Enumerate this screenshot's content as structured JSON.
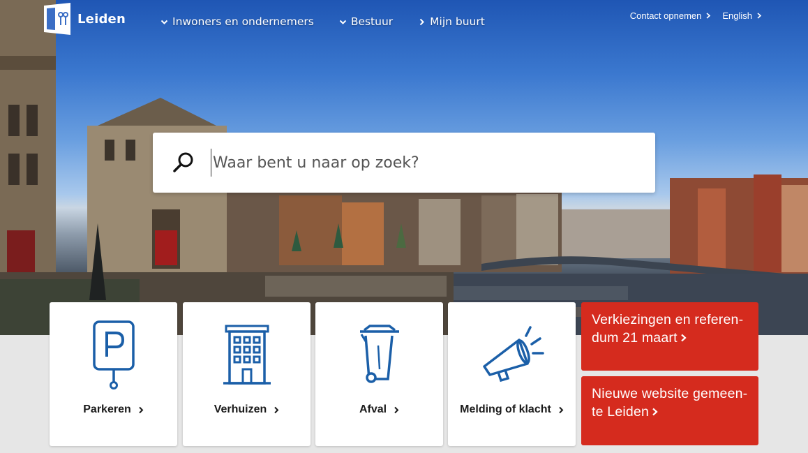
{
  "header": {
    "logo_text": "Leiden",
    "nav": [
      {
        "label": "Inwoners en ondernemers",
        "icon": "chevron-down-icon"
      },
      {
        "label": "Bestuur",
        "icon": "chevron-down-icon"
      },
      {
        "label": "Mijn buurt",
        "icon": "chevron-right-icon"
      }
    ],
    "top_links": [
      {
        "label": "Contact opnemen",
        "icon": "chevron-right-icon"
      },
      {
        "label": "English",
        "icon": "chevron-right-icon"
      }
    ]
  },
  "search": {
    "placeholder": "Waar bent u naar op zoek?",
    "icon": "search-icon"
  },
  "tiles": [
    {
      "label": "Parkeren",
      "icon": "parking-sign-icon"
    },
    {
      "label": "Verhuizen",
      "icon": "building-icon"
    },
    {
      "label": "Afval",
      "icon": "trash-bin-icon"
    },
    {
      "label": "Melding of klacht",
      "icon": "megaphone-icon"
    }
  ],
  "promos": [
    {
      "line1": "Verkiezingen en referen-",
      "line2": "dum 21 maart"
    },
    {
      "line1": "Nieuwe website gemeen-",
      "line2": "te Leiden"
    }
  ],
  "colors": {
    "accent_red": "#d52b1e",
    "icon_blue": "#1b5fa8",
    "sky_blue": "#2a63bd"
  }
}
